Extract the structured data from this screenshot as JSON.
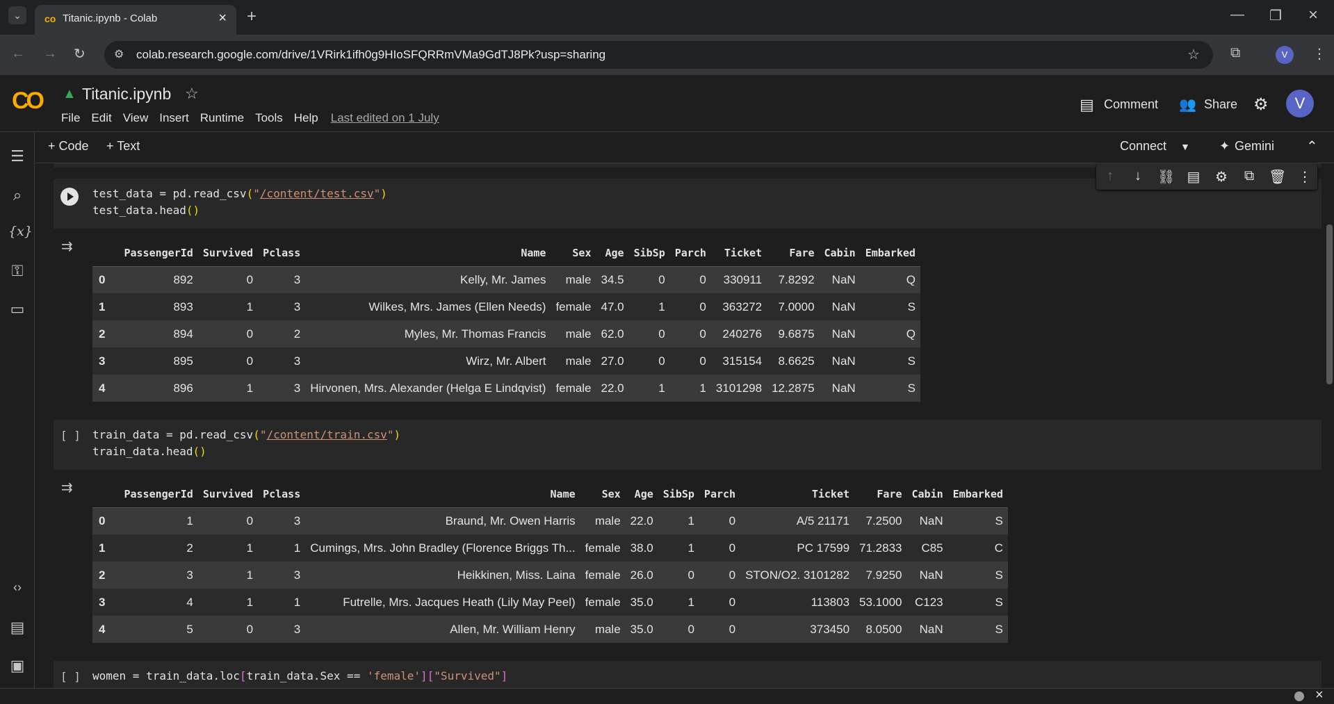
{
  "browser": {
    "tab_title": "Titanic.ipynb - Colab",
    "url": "colab.research.google.com/drive/1VRirk1ifh0g9HIoSFQRRmVMa9GdTJ8Pk?usp=sharing",
    "profile_initial": "V"
  },
  "header": {
    "logo_text": "CO",
    "notebook_title": "Titanic.ipynb",
    "menu": [
      "File",
      "Edit",
      "View",
      "Insert",
      "Runtime",
      "Tools",
      "Help"
    ],
    "last_edited": "Last edited on 1 July",
    "comment_label": "Comment",
    "share_label": "Share",
    "avatar_initial": "V"
  },
  "nb_toolbar": {
    "add_code": "+ Code",
    "add_text": "+ Text",
    "connect": "Connect",
    "gemini": "Gemini"
  },
  "cells": [
    {
      "exec": "",
      "code_line1": "test_data = pd.read_csv(\"/content/test.csv\")",
      "code_line2": "test_data.head()",
      "table": {
        "columns": [
          "",
          "PassengerId",
          "Survived",
          "Pclass",
          "Name",
          "Sex",
          "Age",
          "SibSp",
          "Parch",
          "Ticket",
          "Fare",
          "Cabin",
          "Embarked"
        ],
        "rows": [
          [
            "0",
            "892",
            "0",
            "3",
            "Kelly, Mr. James",
            "male",
            "34.5",
            "0",
            "0",
            "330911",
            "7.8292",
            "NaN",
            "Q"
          ],
          [
            "1",
            "893",
            "1",
            "3",
            "Wilkes, Mrs. James (Ellen Needs)",
            "female",
            "47.0",
            "1",
            "0",
            "363272",
            "7.0000",
            "NaN",
            "S"
          ],
          [
            "2",
            "894",
            "0",
            "2",
            "Myles, Mr. Thomas Francis",
            "male",
            "62.0",
            "0",
            "0",
            "240276",
            "9.6875",
            "NaN",
            "Q"
          ],
          [
            "3",
            "895",
            "0",
            "3",
            "Wirz, Mr. Albert",
            "male",
            "27.0",
            "0",
            "0",
            "315154",
            "8.6625",
            "NaN",
            "S"
          ],
          [
            "4",
            "896",
            "1",
            "3",
            "Hirvonen, Mrs. Alexander (Helga E Lindqvist)",
            "female",
            "22.0",
            "1",
            "1",
            "3101298",
            "12.2875",
            "NaN",
            "S"
          ]
        ]
      }
    },
    {
      "exec": "[ ]",
      "code_line1": "train_data = pd.read_csv(\"/content/train.csv\")",
      "code_line2": "train_data.head()",
      "table": {
        "columns": [
          "",
          "PassengerId",
          "Survived",
          "Pclass",
          "Name",
          "Sex",
          "Age",
          "SibSp",
          "Parch",
          "Ticket",
          "Fare",
          "Cabin",
          "Embarked"
        ],
        "rows": [
          [
            "0",
            "1",
            "0",
            "3",
            "Braund, Mr. Owen Harris",
            "male",
            "22.0",
            "1",
            "0",
            "A/5 21171",
            "7.2500",
            "NaN",
            "S"
          ],
          [
            "1",
            "2",
            "1",
            "1",
            "Cumings, Mrs. John Bradley (Florence Briggs Th...",
            "female",
            "38.0",
            "1",
            "0",
            "PC 17599",
            "71.2833",
            "C85",
            "C"
          ],
          [
            "2",
            "3",
            "1",
            "3",
            "Heikkinen, Miss. Laina",
            "female",
            "26.0",
            "0",
            "0",
            "STON/O2. 3101282",
            "7.9250",
            "NaN",
            "S"
          ],
          [
            "3",
            "4",
            "1",
            "1",
            "Futrelle, Mrs. Jacques Heath (Lily May Peel)",
            "female",
            "35.0",
            "1",
            "0",
            "113803",
            "53.1000",
            "C123",
            "S"
          ],
          [
            "4",
            "5",
            "0",
            "3",
            "Allen, Mr. William Henry",
            "male",
            "35.0",
            "0",
            "0",
            "373450",
            "8.0500",
            "NaN",
            "S"
          ]
        ]
      }
    },
    {
      "exec": "[ ]",
      "code_line1": "women = train_data.loc[train_data.Sex == 'female'][\"Survived\"]"
    }
  ],
  "colors": {
    "background": "#1e1e1e",
    "cell_bg": "#282828",
    "string": "#ce9178",
    "accent": "#5865c6"
  }
}
